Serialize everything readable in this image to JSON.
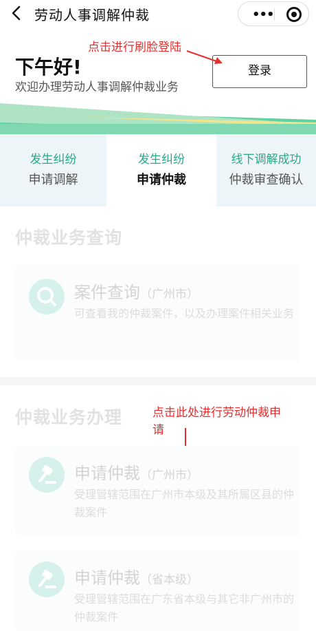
{
  "nav": {
    "title": "劳动人事调解仲裁",
    "more_icon": "more-dots-icon",
    "close_icon": "target-close-icon"
  },
  "header": {
    "greeting": "下午好!",
    "subtitle": "欢迎办理劳动人事调解仲裁业务",
    "login_label": "登录"
  },
  "annotations": {
    "face_login": "点击进行刷脸登陆",
    "apply_line1": "点击此处进行劳动仲裁申",
    "apply_line2": "请"
  },
  "tabs": [
    {
      "line1": "发生纠纷",
      "line2": "申请调解"
    },
    {
      "line1": "发生纠纷",
      "line2": "申请仲裁"
    },
    {
      "line1": "线下调解成功",
      "line2": "仲裁审查确认"
    }
  ],
  "query_section": {
    "title": "仲裁业务查询",
    "card": {
      "title": "案件查询",
      "scope": "（广州市）",
      "desc": "可查看我的仲裁案件，以及办理案件相关业务"
    }
  },
  "handle_section": {
    "title": "仲裁业务办理",
    "cards": [
      {
        "title": "申请仲裁",
        "scope": "（广州市）",
        "desc": "受理管辖范围在广州市本级及其所属区县的仲裁案件"
      },
      {
        "title": "申请仲裁",
        "scope": "（省本级）",
        "desc": "受理管辖范围在广东省本级与其它非广州市的仲裁案件"
      }
    ]
  },
  "colors": {
    "accent_green": "#2aa88a",
    "annotation_red": "#e53030"
  }
}
